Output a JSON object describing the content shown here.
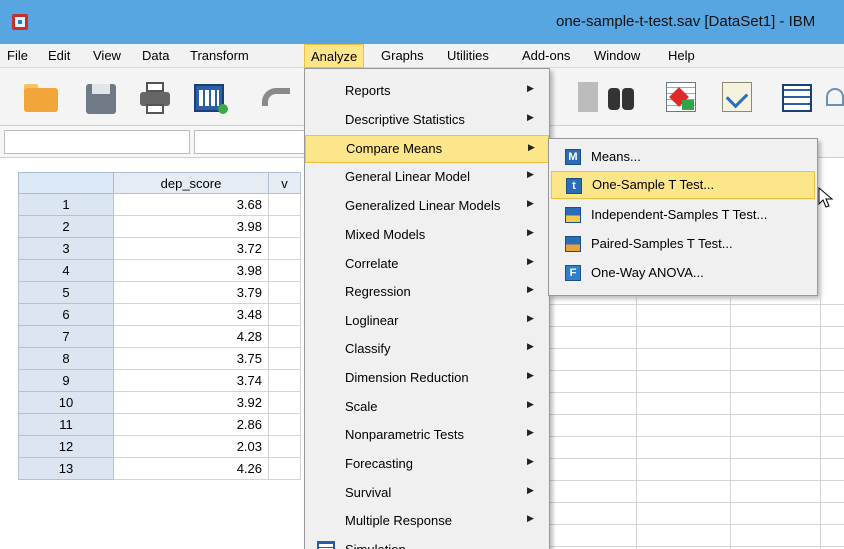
{
  "window": {
    "title": "one-sample-t-test.sav [DataSet1] - IBM"
  },
  "menubar": {
    "items": [
      "File",
      "Edit",
      "View",
      "Data",
      "Transform",
      "Analyze",
      "Graphs",
      "Utilities",
      "Add-ons",
      "Window",
      "Help"
    ],
    "active": "Analyze"
  },
  "toolbar": {
    "icons": [
      "open-icon",
      "save-icon",
      "print-icon",
      "data-icon",
      "undo-icon",
      "variable-icon",
      "binoculars-icon",
      "select-cases-icon",
      "weight-icon",
      "value-labels-icon",
      "scale-icon"
    ]
  },
  "grid": {
    "columns": [
      "dep_score",
      "v"
    ],
    "rows": [
      {
        "num": "1",
        "dep_score": "3.68"
      },
      {
        "num": "2",
        "dep_score": "3.98"
      },
      {
        "num": "3",
        "dep_score": "3.72"
      },
      {
        "num": "4",
        "dep_score": "3.98"
      },
      {
        "num": "5",
        "dep_score": "3.79"
      },
      {
        "num": "6",
        "dep_score": "3.48"
      },
      {
        "num": "7",
        "dep_score": "4.28"
      },
      {
        "num": "8",
        "dep_score": "3.75"
      },
      {
        "num": "9",
        "dep_score": "3.74"
      },
      {
        "num": "10",
        "dep_score": "3.92"
      },
      {
        "num": "11",
        "dep_score": "2.86"
      },
      {
        "num": "12",
        "dep_score": "2.03"
      },
      {
        "num": "13",
        "dep_score": "4.26"
      }
    ]
  },
  "analyze_menu": {
    "items": [
      {
        "label": "Reports",
        "submenu": true
      },
      {
        "label": "Descriptive Statistics",
        "submenu": true
      },
      {
        "label": "Compare Means",
        "submenu": true,
        "highlighted": true
      },
      {
        "label": "General Linear Model",
        "submenu": true
      },
      {
        "label": "Generalized Linear Models",
        "submenu": true
      },
      {
        "label": "Mixed Models",
        "submenu": true
      },
      {
        "label": "Correlate",
        "submenu": true
      },
      {
        "label": "Regression",
        "submenu": true
      },
      {
        "label": "Loglinear",
        "submenu": true
      },
      {
        "label": "Classify",
        "submenu": true
      },
      {
        "label": "Dimension Reduction",
        "submenu": true
      },
      {
        "label": "Scale",
        "submenu": true
      },
      {
        "label": "Nonparametric Tests",
        "submenu": true
      },
      {
        "label": "Forecasting",
        "submenu": true
      },
      {
        "label": "Survival",
        "submenu": true
      },
      {
        "label": "Multiple Response",
        "submenu": true
      },
      {
        "label": "Simulation...",
        "icon": "simulation-icon"
      }
    ]
  },
  "compare_means_submenu": {
    "items": [
      {
        "label": "Means...",
        "icon": "means-icon",
        "glyph": "M"
      },
      {
        "label": "One-Sample T Test...",
        "icon": "one-sample-t-test-icon",
        "glyph": "t",
        "highlighted": true
      },
      {
        "label": "Independent-Samples T Test...",
        "icon": "independent-samples-t-test-icon",
        "glyph": ""
      },
      {
        "label": "Paired-Samples T Test...",
        "icon": "paired-samples-t-test-icon",
        "glyph": ""
      },
      {
        "label": "One-Way ANOVA...",
        "icon": "one-way-anova-icon",
        "glyph": "F"
      }
    ]
  },
  "colors": {
    "title_bar": "#58a6e1",
    "highlight": "#fde58a",
    "highlight_border": "#f0c23a",
    "menu_bg": "#f0f0f0"
  }
}
